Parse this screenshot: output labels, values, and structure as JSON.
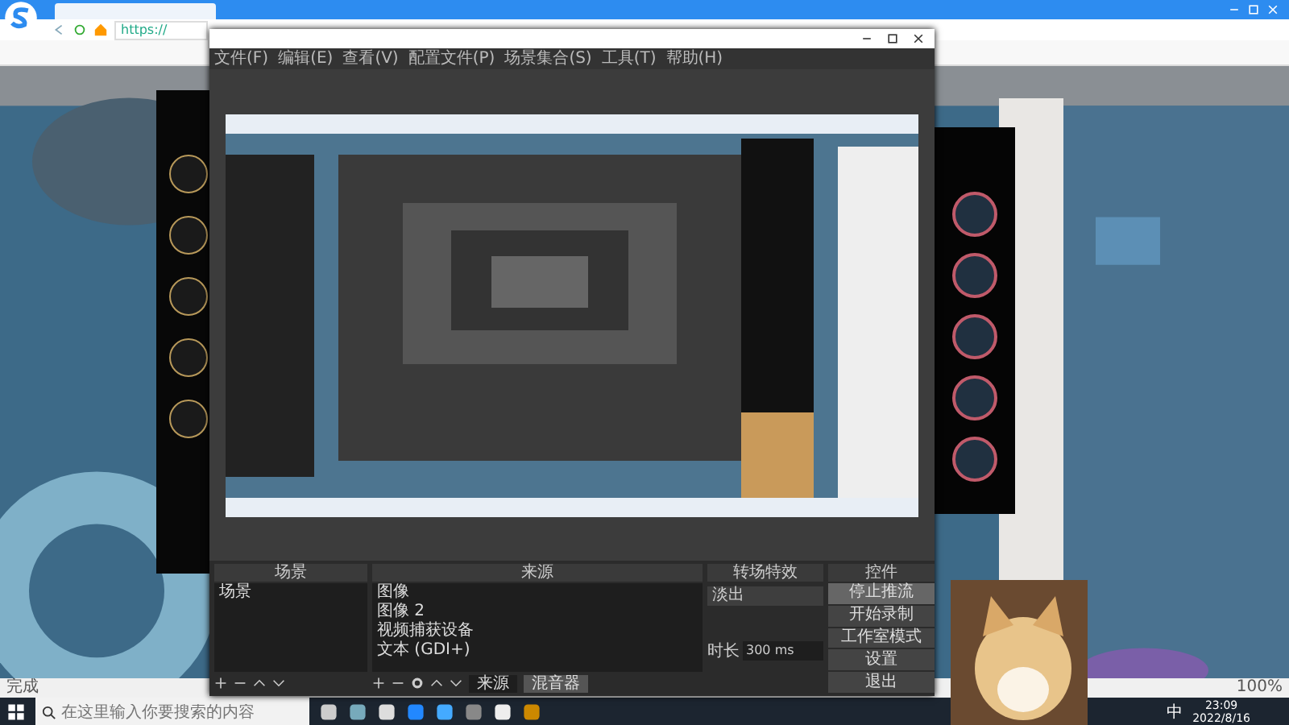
{
  "browser": {
    "address": "https://",
    "zoom": "100%",
    "status": "完成"
  },
  "obs": {
    "menu": [
      "文件(F)",
      "编辑(E)",
      "查看(V)",
      "配置文件(P)",
      "场景集合(S)",
      "工具(T)",
      "帮助(H)"
    ],
    "docks": [
      "场景",
      "来源",
      "转场特效",
      "控件"
    ],
    "scenes": [
      {
        "label": "场景",
        "selected": false
      }
    ],
    "sources": [
      "图像",
      "图像 2",
      "视频捕获设备",
      "文本 (GDI+)"
    ],
    "transition": {
      "value": "淡出",
      "duration_label": "时长",
      "duration": "300 ms"
    },
    "controls": [
      "停止推流",
      "开始录制",
      "工作室模式",
      "设置",
      "退出"
    ],
    "tabs": [
      {
        "label": "来源",
        "selected": true
      },
      {
        "label": "混音器",
        "selected": false
      }
    ]
  },
  "taskbar": {
    "search": {
      "placeholder": "在这里输入你要搜索的内容"
    },
    "ime": "中",
    "time": "23:09",
    "date": "2022/8/16"
  }
}
